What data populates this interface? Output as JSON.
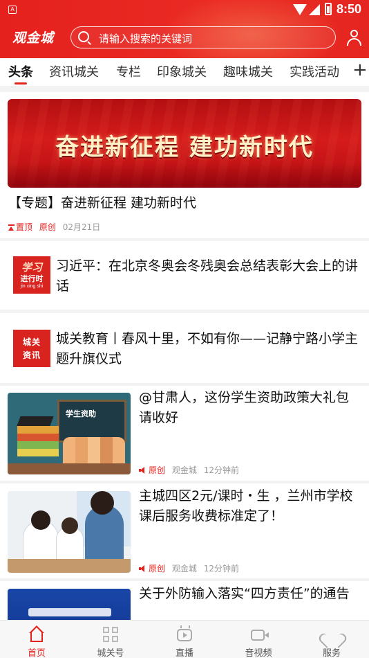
{
  "status_bar": {
    "time": "8:50",
    "notification_icon_text": "A"
  },
  "header": {
    "logo_text": "观金城",
    "search_placeholder": "请输入搜索的关键词"
  },
  "tabs": [
    {
      "label": "头条",
      "active": true
    },
    {
      "label": "资讯城关",
      "active": false
    },
    {
      "label": "专栏",
      "active": false
    },
    {
      "label": "印象城关",
      "active": false
    },
    {
      "label": "趣味城关",
      "active": false
    },
    {
      "label": "实践活动",
      "active": false
    }
  ],
  "tab_add_label": "+",
  "banner": {
    "slogan": "奋进新征程  建功新时代",
    "title": "【专题】奋进新征程  建功新时代",
    "pin_label": "置顶",
    "source_label": "原创",
    "date": "02月21日"
  },
  "articles": [
    {
      "icon_lines": [
        "学习",
        "进行时",
        "jin xing shi"
      ],
      "title": "习近平：在北京冬奥会冬残奥会总结表彰大会上的讲话"
    },
    {
      "icon_lines": [
        "城关",
        "资讯"
      ],
      "title": "城关教育丨春风十里，不如有你——记静宁路小学主题升旗仪式"
    }
  ],
  "thumb_articles": [
    {
      "title": "@甘肃人，这份学生资助政策大礼包请收好",
      "thumb_text": "学生资助",
      "tag": "原创",
      "source": "观金城",
      "time": "12分钟前"
    },
    {
      "title": "主城四区2元/课时・生 ，兰州市学校课后服务收费标准定了！",
      "tag": "原创",
      "source": "观金城",
      "time": "12分钟前"
    },
    {
      "title": "关于外防输入落实“四方责任”的通告"
    }
  ],
  "bottom_nav": [
    {
      "label": "首页",
      "icon": "home-icon",
      "active": true
    },
    {
      "label": "城关号",
      "icon": "grid-icon",
      "active": false
    },
    {
      "label": "直播",
      "icon": "tv-icon",
      "active": false
    },
    {
      "label": "音视频",
      "icon": "video-icon",
      "active": false
    },
    {
      "label": "服务",
      "icon": "heart-icon",
      "active": false
    }
  ],
  "colors": {
    "brand_red": "#e5211d",
    "meta_grey": "#999999"
  }
}
